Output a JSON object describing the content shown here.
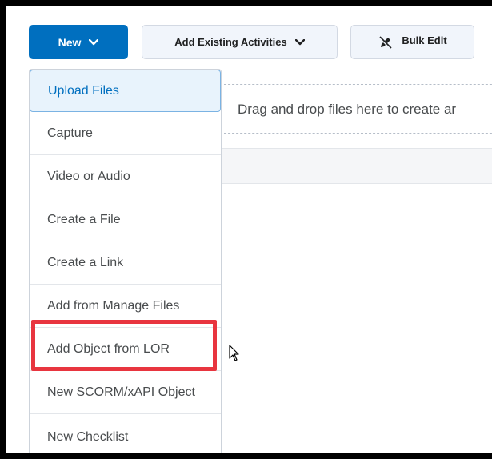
{
  "toolbar": {
    "new_label": "New",
    "add_existing_label": "Add Existing Activities",
    "bulk_edit_label": "Bulk Edit"
  },
  "dropzone": {
    "text": "Drag and drop files here to create ar"
  },
  "menu": {
    "items": [
      {
        "label": "Upload Files"
      },
      {
        "label": "Capture"
      },
      {
        "label": "Video or Audio"
      },
      {
        "label": "Create a File"
      },
      {
        "label": "Create a Link"
      },
      {
        "label": "Add from Manage Files"
      },
      {
        "label": "Add Object from LOR"
      },
      {
        "label": "New SCORM/xAPI Object"
      },
      {
        "label": "New Checklist"
      }
    ]
  },
  "colors": {
    "primary": "#006fbf",
    "highlight": "#e8353f",
    "active_bg": "#e8f3fc"
  },
  "icons": {
    "new_chevron": "chevron-down-icon",
    "add_chevron": "chevron-down-icon",
    "bulk_edit": "pencil-slash-icon",
    "cursor": "mouse-pointer-icon"
  }
}
